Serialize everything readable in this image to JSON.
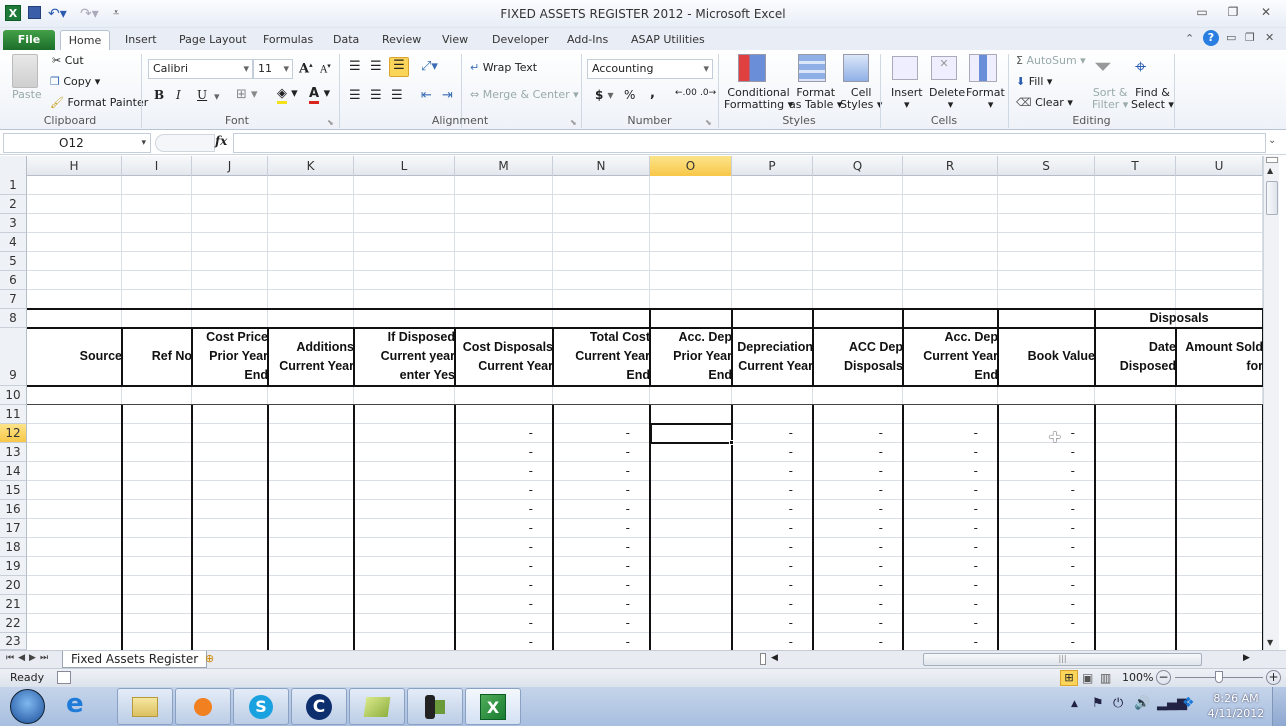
{
  "window": {
    "title": "FIXED ASSETS REGISTER 2012  -  Microsoft Excel",
    "app_icon": "excel-icon",
    "quick_access": [
      "save-icon",
      "undo-icon",
      "redo-icon",
      "customize-icon"
    ],
    "controls": [
      "minimize-icon",
      "restore-icon",
      "close-icon"
    ]
  },
  "tabs": [
    {
      "label": "File"
    },
    {
      "label": "Home",
      "active": true
    },
    {
      "label": "Insert"
    },
    {
      "label": "Page Layout"
    },
    {
      "label": "Formulas"
    },
    {
      "label": "Data"
    },
    {
      "label": "Review"
    },
    {
      "label": "View"
    },
    {
      "label": "Developer"
    },
    {
      "label": "Add-Ins"
    },
    {
      "label": "ASAP Utilities"
    }
  ],
  "ribbon": {
    "clipboard": {
      "label": "Clipboard",
      "paste": "Paste",
      "cut": "Cut",
      "copy": "Copy",
      "format_painter": "Format Painter"
    },
    "font": {
      "label": "Font",
      "name": "Calibri",
      "size": "11",
      "bold": "B",
      "italic": "I",
      "underline": "U",
      "grow": "A",
      "shrink": "A",
      "fill_color": "#f5e11a",
      "font_color": "#d9261c"
    },
    "alignment": {
      "label": "Alignment",
      "wrap_text": "Wrap Text",
      "merge_center": "Merge & Center"
    },
    "number": {
      "label": "Number",
      "format": "Accounting",
      "currency": "$",
      "percent": "%",
      "comma": ",",
      "inc_decimal": ".00",
      "dec_decimal": ".0"
    },
    "styles": {
      "label": "Styles",
      "conditional": [
        "Conditional",
        "Formatting"
      ],
      "format_table": [
        "Format",
        "as Table"
      ],
      "cell_styles": [
        "Cell",
        "Styles"
      ]
    },
    "cells": {
      "label": "Cells",
      "insert": "Insert",
      "delete": "Delete",
      "format": "Format"
    },
    "editing": {
      "label": "Editing",
      "autosum": "AutoSum",
      "fill": "Fill",
      "clear": "Clear",
      "sort": [
        "Sort &",
        "Filter"
      ],
      "find": [
        "Find &",
        "Select"
      ]
    }
  },
  "formula_bar": {
    "name_box": "O12",
    "fx": "fx",
    "value": ""
  },
  "columns": [
    "H",
    "I",
    "J",
    "K",
    "L",
    "M",
    "N",
    "O",
    "P",
    "Q",
    "R",
    "S",
    "T",
    "U"
  ],
  "selected_column": "O",
  "selected_row": "12",
  "rows": [
    "1",
    "2",
    "3",
    "4",
    "5",
    "6",
    "7",
    "8",
    "9",
    "10",
    "11",
    "12",
    "13",
    "14",
    "15",
    "16",
    "17",
    "18",
    "19",
    "20",
    "21",
    "22",
    "23"
  ],
  "table": {
    "group_header": "Disposals",
    "headers": [
      {
        "col": "H",
        "lines": [
          "Source"
        ]
      },
      {
        "col": "I",
        "lines": [
          "Ref No"
        ]
      },
      {
        "col": "J",
        "lines": [
          "Cost Price",
          "Prior Year",
          "End"
        ]
      },
      {
        "col": "K",
        "lines": [
          "Additions",
          "Current Year"
        ]
      },
      {
        "col": "L",
        "lines": [
          "If Disposed",
          "Current year",
          "enter Yes"
        ]
      },
      {
        "col": "M",
        "lines": [
          "Cost Disposals",
          "Current Year"
        ]
      },
      {
        "col": "N",
        "lines": [
          "Total Cost",
          "Current Year",
          "End"
        ]
      },
      {
        "col": "O",
        "lines": [
          "Acc. Dep",
          "Prior Year",
          "End"
        ]
      },
      {
        "col": "P",
        "lines": [
          "Depreciation",
          "Current Year"
        ]
      },
      {
        "col": "Q",
        "lines": [
          "ACC Dep",
          "Disposals"
        ]
      },
      {
        "col": "R",
        "lines": [
          "Acc. Dep",
          "Current Year",
          "End"
        ]
      },
      {
        "col": "S",
        "lines": [
          "Book Value"
        ]
      },
      {
        "col": "T",
        "lines": [
          "Date",
          "Disposed"
        ]
      },
      {
        "col": "U",
        "lines": [
          "Amount Sold",
          "for"
        ]
      }
    ],
    "dash_value": "-",
    "dash_columns": [
      "M",
      "N",
      "P",
      "Q",
      "R",
      "S"
    ],
    "dash_rows": [
      "12",
      "13",
      "14",
      "15",
      "16",
      "17",
      "18",
      "19",
      "20",
      "21",
      "22",
      "23"
    ]
  },
  "sheet_tabs": [
    {
      "label": "Fixed Assets Register",
      "active": true
    }
  ],
  "status": {
    "text": "Ready",
    "zoom": "100%",
    "zoom_level": 1.0
  },
  "taskbar": {
    "apps": [
      "start-orb-icon",
      "internet-explorer-icon",
      "file-explorer-icon",
      "media-player-icon",
      "skype-icon",
      "app-c-icon",
      "notes-icon",
      "camera-icon",
      "excel-icon"
    ],
    "time": "8:26 AM",
    "date": "4/11/2012"
  }
}
